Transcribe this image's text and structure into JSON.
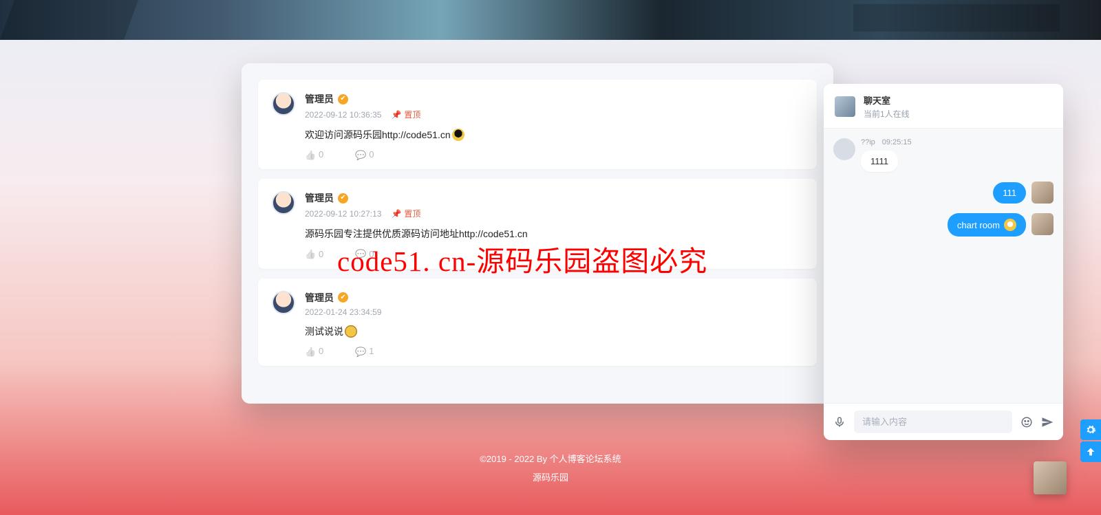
{
  "posts": [
    {
      "author": "管理员",
      "time": "2022-09-12 10:36:35",
      "pin": "置顶",
      "text": "欢迎访问源码乐园http://code51.cn",
      "has_emoji": true,
      "likes": "0",
      "comments": "0"
    },
    {
      "author": "管理员",
      "time": "2022-09-12 10:27:13",
      "pin": "置顶",
      "text": "源码乐园专注提供优质源码访问地址http://code51.cn",
      "has_emoji": false,
      "likes": "0",
      "comments": "0"
    },
    {
      "author": "管理员",
      "time": "2022-01-24 23:34:59",
      "pin": "",
      "text": "测试说说",
      "has_emoji": true,
      "likes": "0",
      "comments": "1"
    }
  ],
  "chat": {
    "title": "聊天室",
    "sub": "当前1人在线",
    "left_msg": {
      "name": "??ip",
      "time": "09:25:15",
      "text": "1111"
    },
    "right_msgs": [
      {
        "text": "111",
        "emoji": false
      },
      {
        "text": "chart room",
        "emoji": true
      }
    ],
    "placeholder": "请输入内容"
  },
  "footer": {
    "line1": "©2019 - 2022 By 个人博客论坛系统",
    "line2": "源码乐园"
  },
  "watermark": "code51. cn-源码乐园盗图必究"
}
